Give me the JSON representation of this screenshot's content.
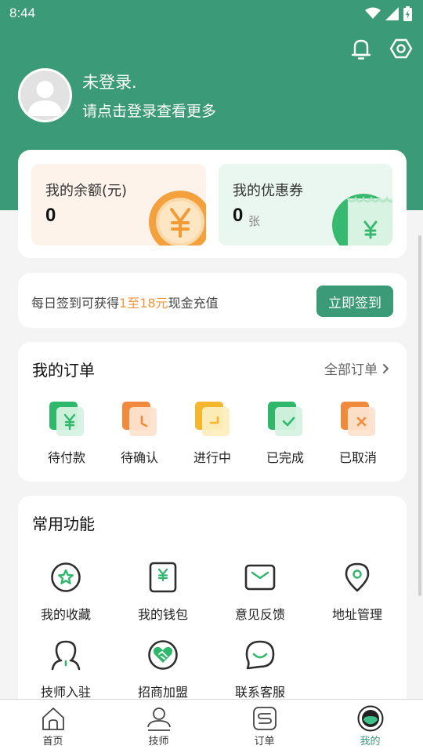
{
  "status_bar": {
    "time": "8:44"
  },
  "header": {
    "notification_icon": "bell-icon",
    "settings_icon": "hexagon-settings-icon",
    "user_name": "未登录.",
    "user_hint": "请点击登录查看更多"
  },
  "wallet": {
    "balance_label": "我的余额(元)",
    "balance_value": "0",
    "coupon_label": "我的优惠券",
    "coupon_value": "0",
    "coupon_unit": "张"
  },
  "signin": {
    "text_prefix": "每日签到可获得",
    "text_highlight": "1至18元",
    "text_suffix": "现金充值",
    "button_label": "立即签到"
  },
  "orders": {
    "title": "我的订单",
    "all_label": "全部订单",
    "items": [
      {
        "label": "待付款",
        "icon": "pending-payment-icon"
      },
      {
        "label": "待确认",
        "icon": "pending-confirm-icon"
      },
      {
        "label": "进行中",
        "icon": "in-progress-icon"
      },
      {
        "label": "已完成",
        "icon": "completed-icon"
      },
      {
        "label": "已取消",
        "icon": "cancelled-icon"
      }
    ]
  },
  "functions": {
    "title": "常用功能",
    "items": [
      {
        "label": "我的收藏",
        "icon": "favorite-star-icon"
      },
      {
        "label": "我的钱包",
        "icon": "wallet-icon"
      },
      {
        "label": "意见反馈",
        "icon": "feedback-mail-icon"
      },
      {
        "label": "地址管理",
        "icon": "location-pin-icon"
      },
      {
        "label": "技师入驻",
        "icon": "technician-join-icon"
      },
      {
        "label": "招商加盟",
        "icon": "handshake-icon"
      },
      {
        "label": "联系客服",
        "icon": "customer-service-icon"
      }
    ]
  },
  "tabbar": {
    "tabs": [
      {
        "label": "首页",
        "icon": "home-icon"
      },
      {
        "label": "技师",
        "icon": "technician-icon"
      },
      {
        "label": "订单",
        "icon": "order-icon"
      },
      {
        "label": "我的",
        "icon": "profile-icon",
        "active": true
      }
    ]
  },
  "colors": {
    "brand_green": "#3b9a78",
    "highlight_orange": "#f0953a"
  }
}
